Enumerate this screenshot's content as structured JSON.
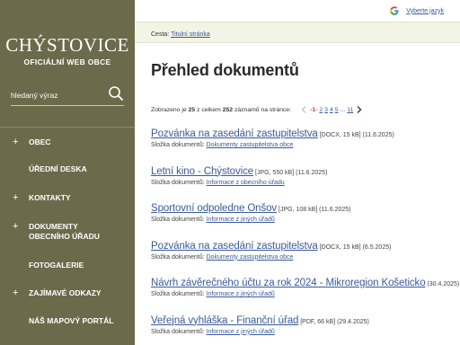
{
  "brand": {
    "title": "CHÝSTOVICE",
    "subtitle": "OFICIÁLNÍ WEB OBCE"
  },
  "search": {
    "placeholder": "hledaný výraz"
  },
  "nav": [
    {
      "label": "OBEC",
      "expandable": true
    },
    {
      "label": "ÚŘEDNÍ DESKA",
      "expandable": false
    },
    {
      "label": "KONTAKTY",
      "expandable": true
    },
    {
      "label": "DOKUMENTY OBECNÍHO ÚŘADU",
      "expandable": true
    },
    {
      "label": "FOTOGALERIE",
      "expandable": false
    },
    {
      "label": "ZAJÍMAVÉ ODKAZY",
      "expandable": true
    },
    {
      "label": "NÁŠ MAPOVÝ PORTÁL",
      "expandable": false
    }
  ],
  "lang": {
    "label": "Vyberte jazyk"
  },
  "breadcrumb": {
    "prefix": "Cesta:",
    "home": "Titulní stránka"
  },
  "title": "Přehled dokumentů",
  "pager": {
    "text_shown": "Zobrazeno je",
    "shown": "25",
    "text_of": "z celkem",
    "total": "252",
    "text_records": "záznamů na stránce:",
    "current": "-1-",
    "pages": [
      "2",
      "3",
      "4",
      "5"
    ],
    "dots": "...",
    "last": "11"
  },
  "folder_label": "Složka dokumentů:",
  "documents": [
    {
      "title": "Pozvánka na zasedání zastupitelstva",
      "meta": "[DOCX, 15 kB] (11.6.2025)",
      "folder": "Dokumenty zastupitelstva obce"
    },
    {
      "title": "Letní kino - Chýstovice",
      "meta": "[JPG, 550 kB] (11.6.2025)",
      "folder": "Informace z obecního úřadu"
    },
    {
      "title": "Sportovní odpoledne Onšov",
      "meta": "[JPG, 108 kB] (11.6.2025)",
      "folder": "Informace z jiných úřadů"
    },
    {
      "title": "Pozvánka na zasedání zastupitelstva",
      "meta": "[DOCX, 15 kB] (6.5.2025)",
      "folder": "Dokumenty zastupitelstva obce"
    },
    {
      "title": "Návrh závěrečného účtu za rok 2024 - Mikroregion Košeticko",
      "meta": "(30.4.2025)",
      "folder": "Informace z jiných úřadů"
    },
    {
      "title": "Veřejná vyhláška - Finanční úřad",
      "meta": "[PDF, 66 kB] (29.4.2025)",
      "folder": "Informace z jiných úřadů"
    }
  ]
}
